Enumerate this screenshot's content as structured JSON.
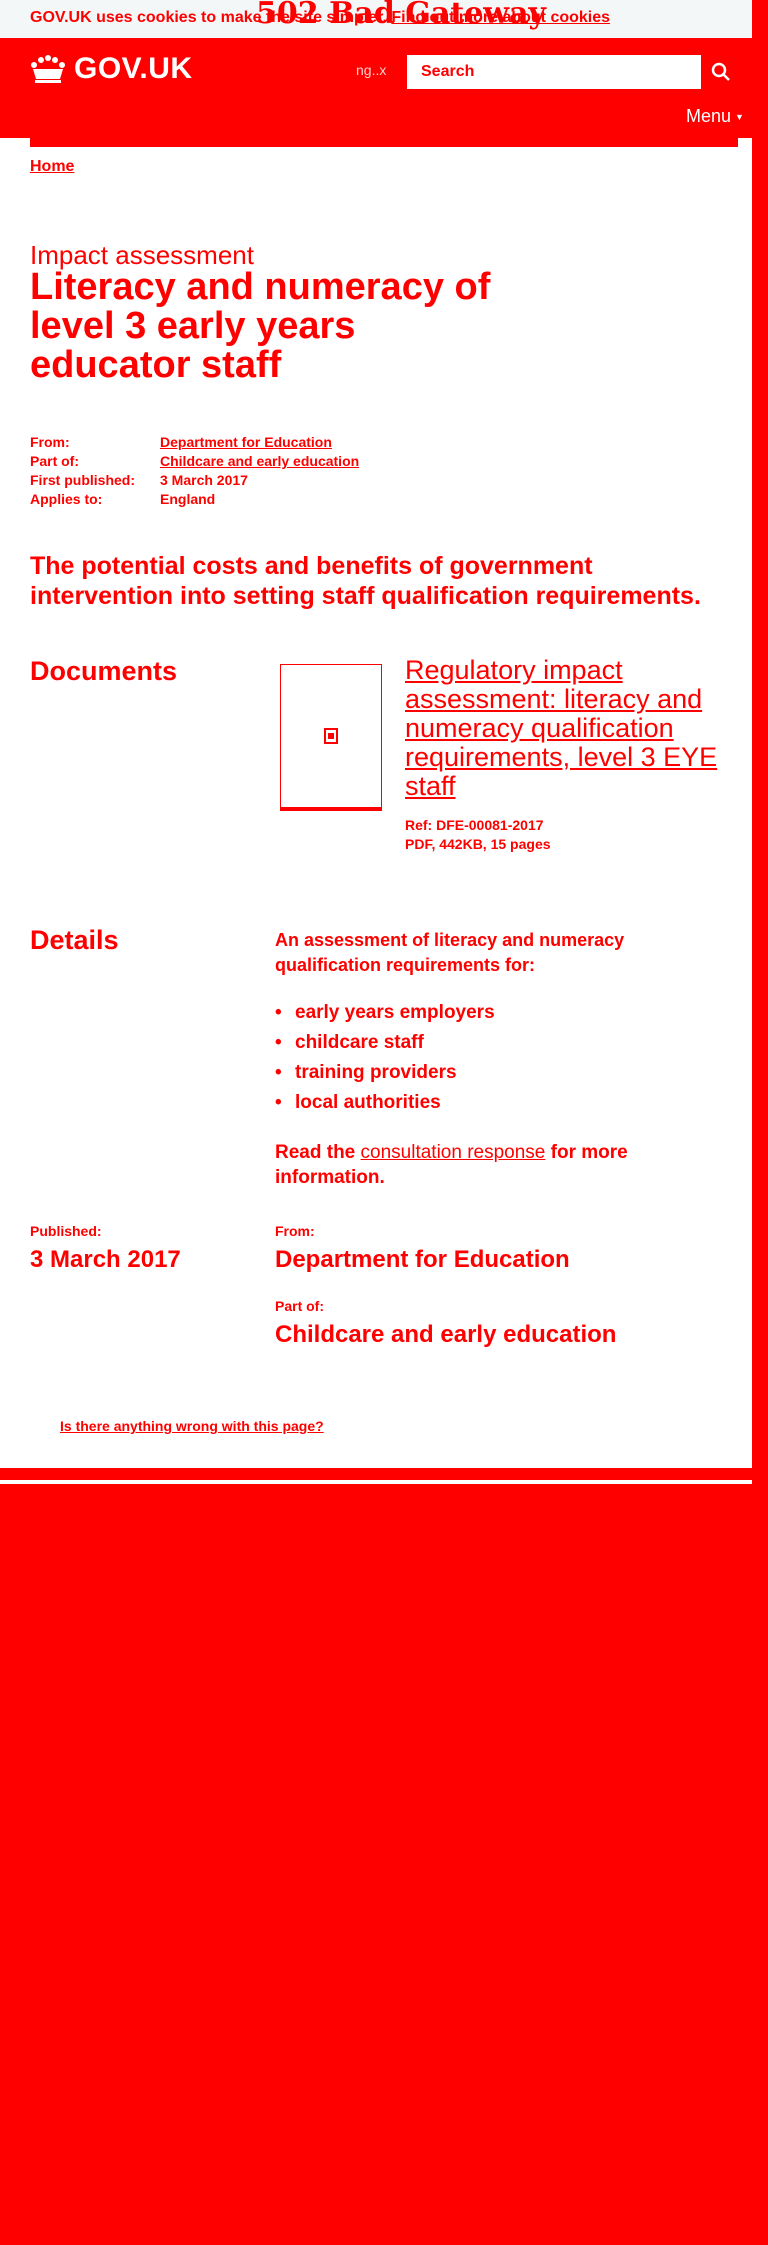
{
  "cookie_banner": {
    "text": "GOV.UK uses cookies to make the site simpler.",
    "link": "Find out more about cookies"
  },
  "error_overlay": "502 Bad Gateway",
  "header": {
    "logo_text": "GOV.UK",
    "nav_ghost": "ng..x",
    "search_placeholder": "Search",
    "menu_label": "Menu",
    "menu_caret": "▼"
  },
  "breadcrumb": {
    "home": "Home"
  },
  "page": {
    "caption": "Impact assessment",
    "title": "Literacy and numeracy of level 3 early years educator staff",
    "lead": "The potential costs and benefits of government intervention into setting staff qualification requirements."
  },
  "metadata": {
    "from_label": "From:",
    "from_value": "Department for Education",
    "partof_label": "Part of:",
    "partof_value": "Childcare and early education",
    "published_label": "First published:",
    "published_value": "3 March 2017",
    "applies_label": "Applies to:",
    "applies_value": "England"
  },
  "documents": {
    "heading": "Documents",
    "title": "Regulatory impact assessment: literacy and numeracy qualification requirements, level 3 EYE staff",
    "ref": "Ref: DFE-00081-2017",
    "file_info": "PDF, 442KB, 15 pages"
  },
  "details": {
    "heading": "Details",
    "intro": "An assessment of literacy and numeracy qualification requirements for:",
    "items": [
      "early years employers",
      "childcare staff",
      "training providers",
      "local authorities"
    ],
    "more_prefix": "Read the ",
    "more_link": "consultation response",
    "more_suffix": " for more information."
  },
  "footer_meta": {
    "published_label": "Published:",
    "published_value": "3 March 2017",
    "from_label": "From:",
    "from_value": "Department for Education",
    "partof_label": "Part of:",
    "partof_value": "Childcare and early education"
  },
  "feedback_link": "Is there anything wrong with this page?",
  "colors": {
    "primary": "#ff0000",
    "page": "#ffffff",
    "cookie_bg": "#f3f7f8"
  }
}
